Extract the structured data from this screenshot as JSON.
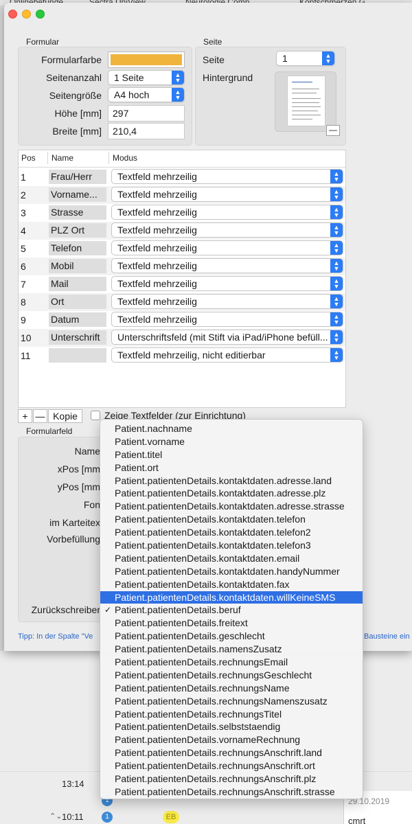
{
  "bookmarks": [
    "Onlinebefunde",
    "Sectra UniView",
    "Neurologie Comp",
    "Kopfschmerzen G"
  ],
  "formular": {
    "group_label": "Formular",
    "farbe_label": "Formularfarbe",
    "farbe_color": "#f0b43c",
    "seitenanzahl_label": "Seitenanzahl",
    "seitenanzahl_value": "1 Seite",
    "seitengroesse_label": "Seitengröße",
    "seitengroesse_value": "A4 hoch",
    "hoehe_label": "Höhe [mm]",
    "hoehe_value": "297",
    "breite_label": "Breite [mm]",
    "breite_value": "210,4"
  },
  "seite": {
    "group_label": "Seite",
    "seite_label": "Seite",
    "seite_value": "1",
    "hintergrund_label": "Hintergrund",
    "remove_label": "—"
  },
  "table": {
    "col_pos": "Pos",
    "col_name": "Name",
    "col_modus": "Modus",
    "rows": [
      {
        "pos": "1",
        "name": "Frau/Herr",
        "modus": "Textfeld mehrzeilig"
      },
      {
        "pos": "2",
        "name": "Vorname...",
        "modus": "Textfeld mehrzeilig"
      },
      {
        "pos": "3",
        "name": "Strasse",
        "modus": "Textfeld mehrzeilig"
      },
      {
        "pos": "4",
        "name": "PLZ Ort",
        "modus": "Textfeld mehrzeilig"
      },
      {
        "pos": "5",
        "name": "Telefon",
        "modus": "Textfeld mehrzeilig"
      },
      {
        "pos": "6",
        "name": "Mobil",
        "modus": "Textfeld mehrzeilig"
      },
      {
        "pos": "7",
        "name": "Mail",
        "modus": "Textfeld mehrzeilig"
      },
      {
        "pos": "8",
        "name": "Ort",
        "modus": "Textfeld mehrzeilig"
      },
      {
        "pos": "9",
        "name": "Datum",
        "modus": "Textfeld mehrzeilig"
      },
      {
        "pos": "10",
        "name": "Unterschrift",
        "modus": "Unterschriftsfeld (mit Stift via iPad/iPhone befüll..."
      },
      {
        "pos": "11",
        "name": "",
        "modus": "Textfeld mehrzeilig, nicht editierbar"
      }
    ]
  },
  "toolbar": {
    "add_label": "+",
    "remove_label": "—",
    "kopie_label": "Kopie",
    "zeige_label": "Zeige Textfelder (zur Einrichtung)"
  },
  "formularfeld": {
    "group_label": "Formularfeld",
    "name_label": "Name",
    "xpos_label": "xPos [mm",
    "ypos_label": "yPos [mm",
    "font_label": "Fon",
    "karteitext_label": "im Karteitex",
    "vorbefuellung_label": "Vorbefüllung",
    "zurueck_label": "Zurückschreiber"
  },
  "tip": {
    "left": "Tipp: In der Spalte \"Ve",
    "right": "Bausteine ein"
  },
  "background_list": {
    "times": [
      "13:14",
      "10:11"
    ],
    "badge": "1",
    "eb": "EB",
    "date": "29.10.2019",
    "cmrt": "cmrt"
  },
  "menu": {
    "highlighted_index": 13,
    "checked_index": 14,
    "items": [
      "Patient.nachname",
      "Patient.vorname",
      "Patient.titel",
      "Patient.ort",
      "Patient.patientenDetails.kontaktdaten.adresse.land",
      "Patient.patientenDetails.kontaktdaten.adresse.plz",
      "Patient.patientenDetails.kontaktdaten.adresse.strasse",
      "Patient.patientenDetails.kontaktdaten.telefon",
      "Patient.patientenDetails.kontaktdaten.telefon2",
      "Patient.patientenDetails.kontaktdaten.telefon3",
      "Patient.patientenDetails.kontaktdaten.email",
      "Patient.patientenDetails.kontaktdaten.handyNummer",
      "Patient.patientenDetails.kontaktdaten.fax",
      "Patient.patientenDetails.kontaktdaten.willKeineSMS",
      "Patient.patientenDetails.beruf",
      "Patient.patientenDetails.freitext",
      "Patient.patientenDetails.geschlecht",
      "Patient.patientenDetails.namensZusatz",
      "Patient.patientenDetails.rechnungsEmail",
      "Patient.patientenDetails.rechnungsGeschlecht",
      "Patient.patientenDetails.rechnungsName",
      "Patient.patientenDetails.rechnungsNamenszusatz",
      "Patient.patientenDetails.rechnungsTitel",
      "Patient.patientenDetails.selbststaendig",
      "Patient.patientenDetails.vornameRechnung",
      "Patient.patientenDetails.rechnungsAnschrift.land",
      "Patient.patientenDetails.rechnungsAnschrift.ort",
      "Patient.patientenDetails.rechnungsAnschrift.plz",
      "Patient.patientenDetails.rechnungsAnschrift.strasse"
    ]
  }
}
